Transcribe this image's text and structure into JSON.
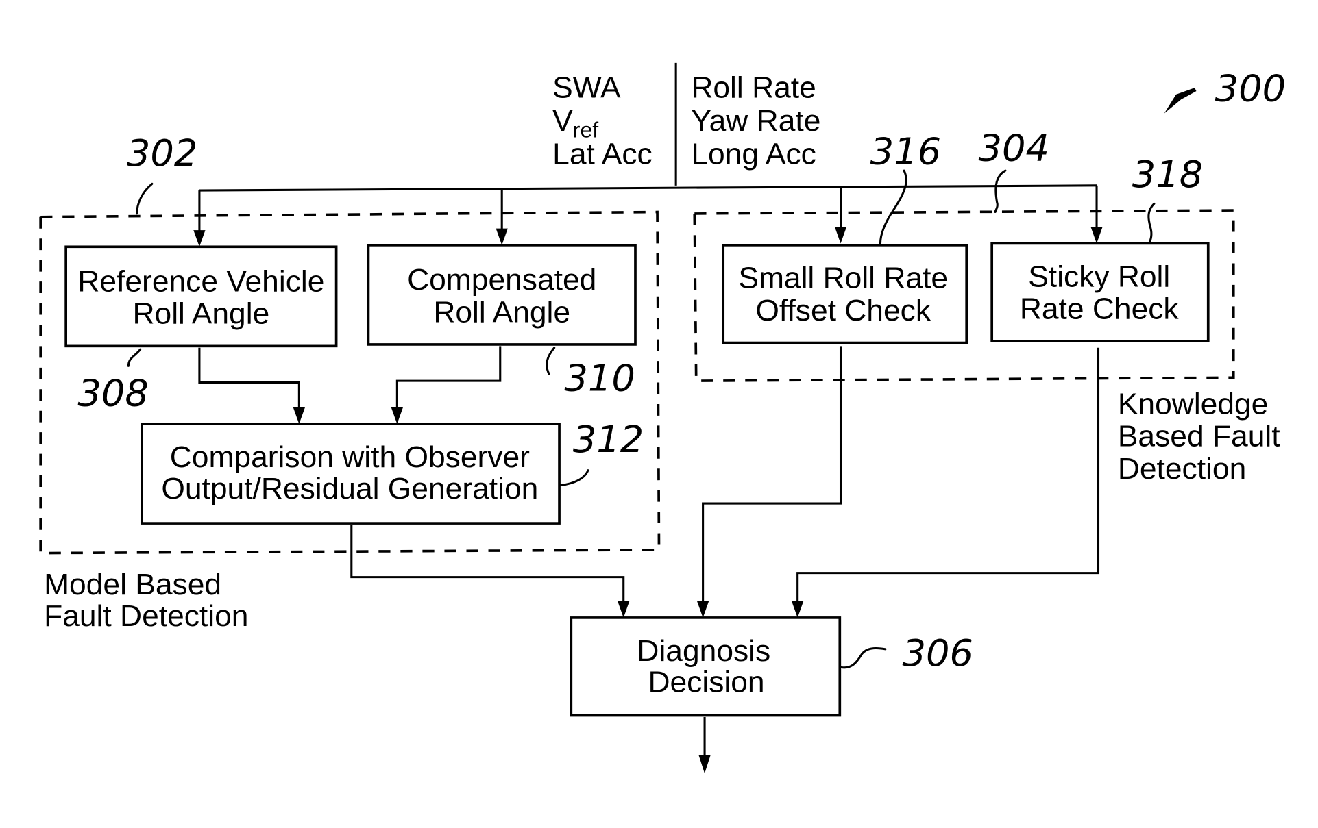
{
  "figure_number": "300",
  "inputs": {
    "left": [
      "SWA",
      "V",
      "Lat Acc"
    ],
    "left_subscript": "ref",
    "right": [
      "Roll Rate",
      "Yaw Rate",
      "Long Acc"
    ]
  },
  "groups": {
    "model_based": {
      "ref": "302",
      "label": [
        "Model Based",
        "Fault Detection"
      ]
    },
    "knowledge_based": {
      "ref": "304",
      "label": [
        "Knowledge",
        "Based Fault",
        "Detection"
      ]
    }
  },
  "blocks": {
    "reference_roll_angle": {
      "ref": "308",
      "lines": [
        "Reference Vehicle",
        "Roll Angle"
      ]
    },
    "compensated_roll_angle": {
      "ref": "310",
      "lines": [
        "Compensated",
        "Roll Angle"
      ]
    },
    "comparison": {
      "ref": "312",
      "lines": [
        "Comparison with Observer",
        "Output/Residual Generation"
      ]
    },
    "small_roll_rate_offset": {
      "ref": "316",
      "lines": [
        "Small Roll Rate",
        "Offset Check"
      ]
    },
    "sticky_roll_rate": {
      "ref": "318",
      "lines": [
        "Sticky Roll",
        "Rate Check"
      ]
    },
    "diagnosis_decision": {
      "ref": "306",
      "lines": [
        "Diagnosis",
        "Decision"
      ]
    }
  }
}
